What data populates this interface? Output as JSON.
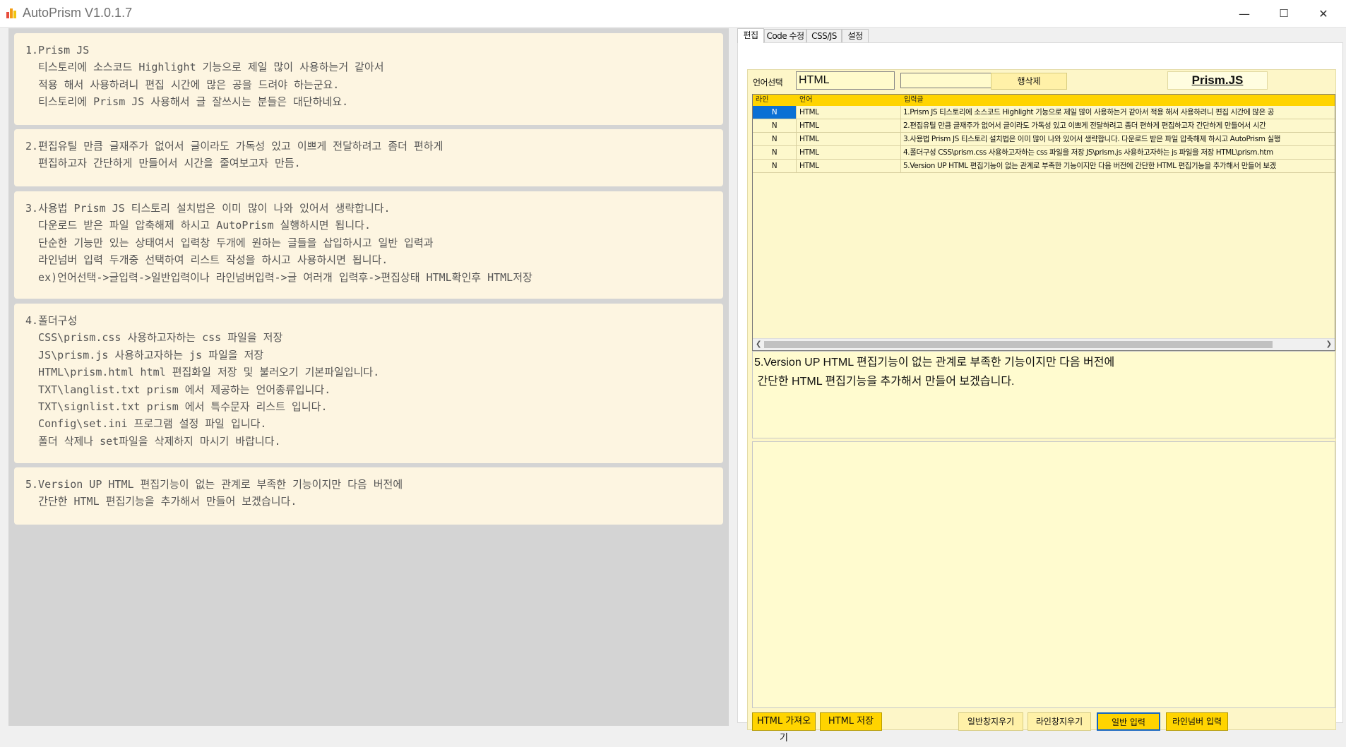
{
  "window": {
    "title": "AutoPrism V1.0.1.7",
    "minimize": "—",
    "maximize": "☐",
    "close": "✕"
  },
  "left_cards": [
    {
      "text": "1.Prism JS\n  티스토리에 소스코드 Highlight 기능으로 제일 많이 사용하는거 같아서\n  적용 해서 사용하려니 편집 시간에 많은 공을 드려야 하는군요.\n  티스토리에 Prism JS 사용해서 글 잘쓰시는 분들은 대단하네요."
    },
    {
      "text": "2.편집유틸 만큼 글재주가 없어서 글이라도 가독성 있고 이쁘게 전달하려고 좀더 편하게\n  편집하고자 간단하게 만들어서 시간을 줄여보고자 만듬."
    },
    {
      "text": "3.사용법 Prism JS 티스토리 설치법은 이미 많이 나와 있어서 생략합니다.\n  다운로드 받은 파일 압축해제 하시고 AutoPrism 실행하시면 됩니다.\n  단순한 기능만 있는 상태여서 입력창 두개에 원하는 글들을 삽입하시고 일반 입력과\n  라인넘버 입력 두개중 선택하여 리스트 작성을 하시고 사용하시면 됩니다.\n  ex)언어선택->글입력->일반입력이나 라인넘버입력->글 여러개 입력후->편집상태 HTML확인후 HTML저장"
    },
    {
      "text": "4.폴더구성\n  CSS\\prism.css 사용하고자하는 css 파일을 저장\n  JS\\prism.js 사용하고자하는 js 파일을 저장\n  HTML\\prism.html html 편집화일 저장 및 불러오기 기본파일입니다.\n  TXT\\langlist.txt prism 에서 제공하는 언어종류입니다.\n  TXT\\signlist.txt prism 에서 특수문자 리스트 입니다.\n  Config\\set.ini 프로그램 설정 파일 입니다.\n  폴더 삭제나 set파일을 삭제하지 마시기 바랍니다."
    },
    {
      "text": "5.Version UP HTML 편집기능이 없는 관계로 부족한 기능이지만 다음 버전에\n  간단한 HTML 편집기능을 추가해서 만들어 보겠습니다."
    }
  ],
  "tabs": [
    "편집",
    "Code 수정",
    "CSS/JS",
    "설정"
  ],
  "toolbar": {
    "lang_label": "언어선택",
    "lang_value": "HTML",
    "combo_value": "",
    "delete_row": "행삭제",
    "prism_js": "Prism.JS"
  },
  "grid": {
    "headers": [
      "라인",
      "언어",
      "입력글"
    ],
    "rows": [
      {
        "line": "N",
        "lang": "HTML",
        "text": "1.Prism JS   티스토리에 소스코드 Highlight 기능으로 제일 많이 사용하는거 같아서   적용 해서 사용하려니 편집 시간에 많은 공"
      },
      {
        "line": "N",
        "lang": "HTML",
        "text": "2.편집유틸 만큼 글재주가 없어서 글이라도 가독성 있고 이쁘게 전달하려고 좀더 편하게   편집하고자 간단하게 만들어서 시간"
      },
      {
        "line": "N",
        "lang": "HTML",
        "text": "3.사용법 Prism JS 티스토리 설치법은 이미 많이 나와 있어서 생략합니다.   다운로드 받은 파일 압축해제 하시고 AutoPrism 실행"
      },
      {
        "line": "N",
        "lang": "HTML",
        "text": "4.폴더구성   CSS\\prism.css 사용하고자하는 css 파일을 저장   JS\\prism.js 사용하고자하는 js 파일을 저장   HTML\\prism.htm"
      },
      {
        "line": "N",
        "lang": "HTML",
        "text": "5.Version UP HTML 편집기능이 없는 관계로 부족한 기능이지만 다음 버전에   간단한 HTML 편집기능을 추가해서 만들어 보겠"
      }
    ]
  },
  "input_top": "5.Version UP HTML 편집기능이 없는 관계로 부족한 기능이지만 다음 버전에\n 간단한 HTML 편집기능을 추가해서 만들어 보겠습니다.",
  "input_bottom": "",
  "buttons": {
    "html_load": "HTML 가져오기",
    "html_save": "HTML 저장",
    "clear_normal": "일반창지우기",
    "clear_line": "라인창지우기",
    "normal_input": "일반 입력",
    "linenum_input": "라인넘버 입력"
  },
  "colors": {
    "accent_yellow": "#ffd400",
    "selection_blue": "#0a70d4",
    "editor_bg": "#fdf6c8",
    "card_bg": "#fdf5e1"
  }
}
